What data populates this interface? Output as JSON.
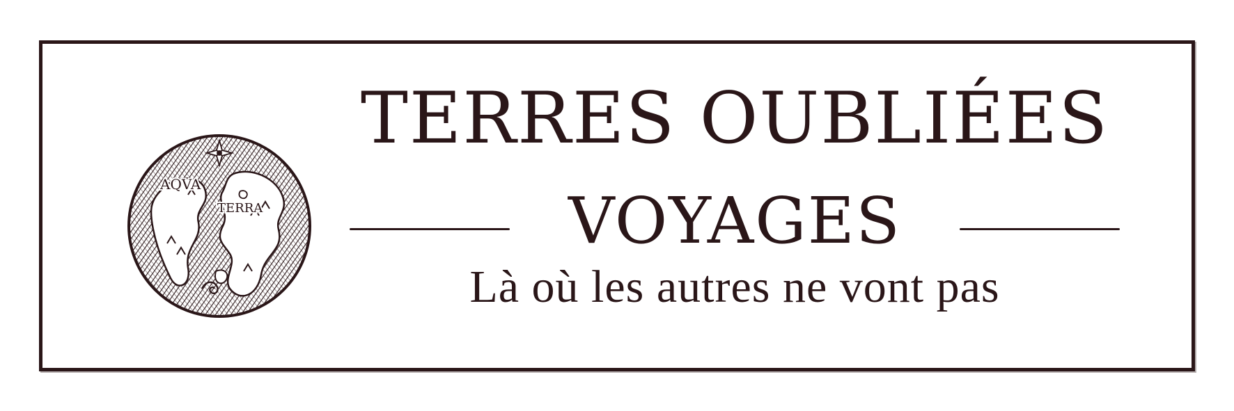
{
  "brand": {
    "title": "TERRES OUBLIÉES",
    "subtitle": "VOYAGES",
    "tagline": "Là où les autres ne vont pas",
    "globe_labels": {
      "sea": "AQVA",
      "land": "TERRA"
    }
  },
  "colors": {
    "ink": "#2a1618",
    "background": "#ffffff"
  },
  "icons": {
    "logo": "engraved-globe-icon",
    "compass": "compass-rose-icon"
  }
}
